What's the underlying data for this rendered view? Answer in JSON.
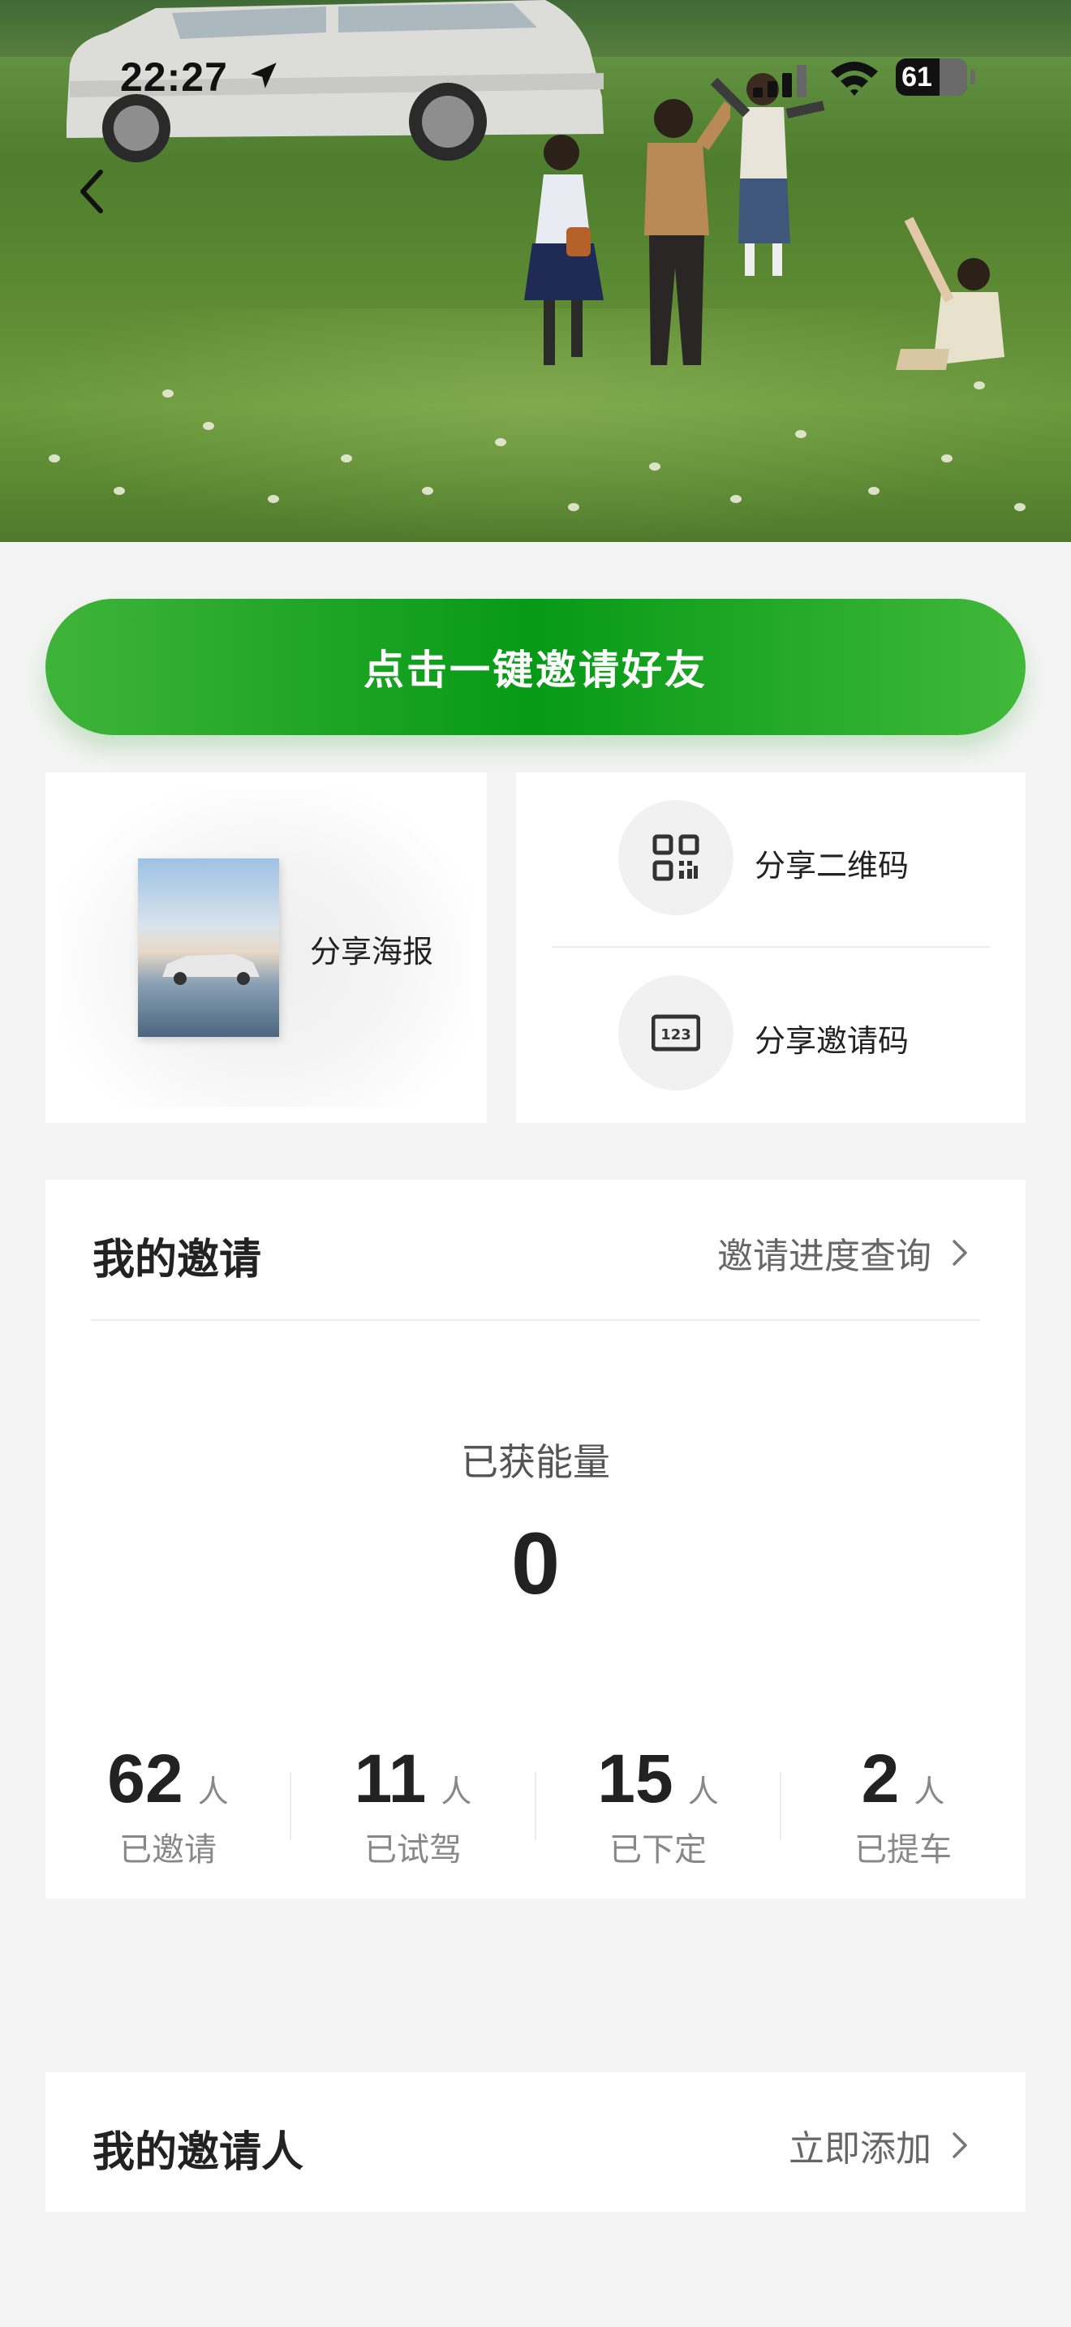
{
  "status_bar": {
    "time": "22:27",
    "battery": "61"
  },
  "hero": {
    "back_icon": "chevron-left-icon"
  },
  "invite_button": {
    "label": "点击一键邀请好友"
  },
  "share": {
    "poster_label": "分享海报",
    "qr_label": "分享二维码",
    "code_label": "分享邀请码"
  },
  "my_invites": {
    "title": "我的邀请",
    "progress_link": "邀请进度查询",
    "energy_label": "已获能量",
    "energy_value": "0",
    "stats": [
      {
        "value": "62",
        "unit": "人",
        "label": "已邀请"
      },
      {
        "value": "11",
        "unit": "人",
        "label": "已试驾"
      },
      {
        "value": "15",
        "unit": "人",
        "label": "已下定"
      },
      {
        "value": "2",
        "unit": "人",
        "label": "已提车"
      }
    ]
  },
  "my_inviter": {
    "title": "我的邀请人",
    "add_link": "立即添加"
  },
  "colors": {
    "accent_green": "#069a16",
    "background": "#f4f4f4"
  }
}
